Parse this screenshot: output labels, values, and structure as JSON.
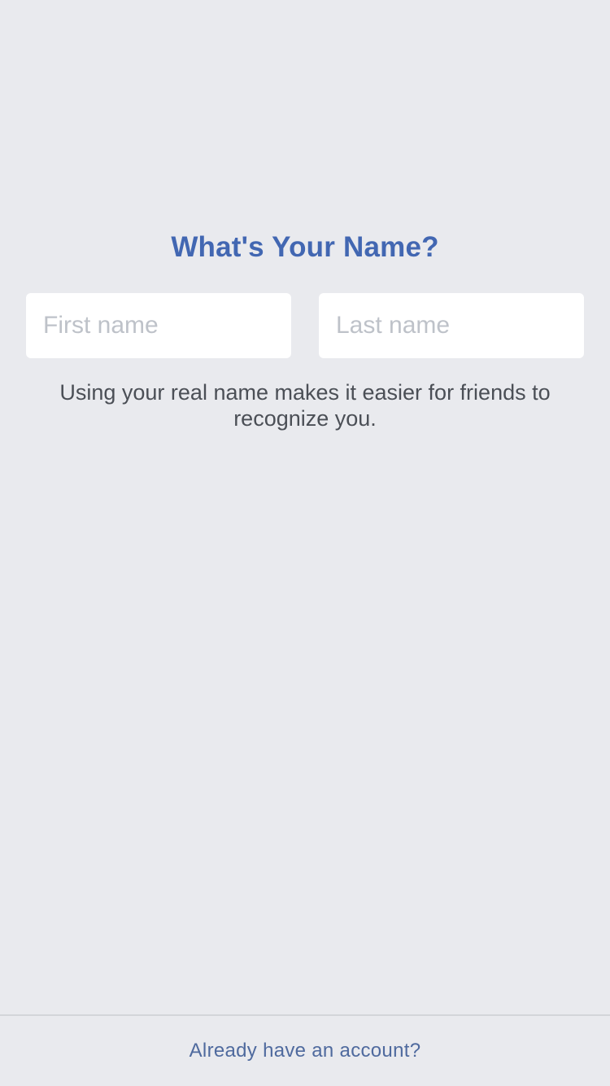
{
  "header": {
    "title": "What's Your Name?"
  },
  "form": {
    "first_name": {
      "value": "",
      "placeholder": "First name"
    },
    "last_name": {
      "value": "",
      "placeholder": "Last name"
    },
    "helper_text": "Using your real name makes it easier for friends to recognize you."
  },
  "footer": {
    "login_link_label": "Already have an account?"
  },
  "colors": {
    "background": "#e9eaee",
    "accent": "#4267b2",
    "link": "#4f6a9e",
    "text": "#4b4f56",
    "placeholder": "#bec2c9"
  }
}
